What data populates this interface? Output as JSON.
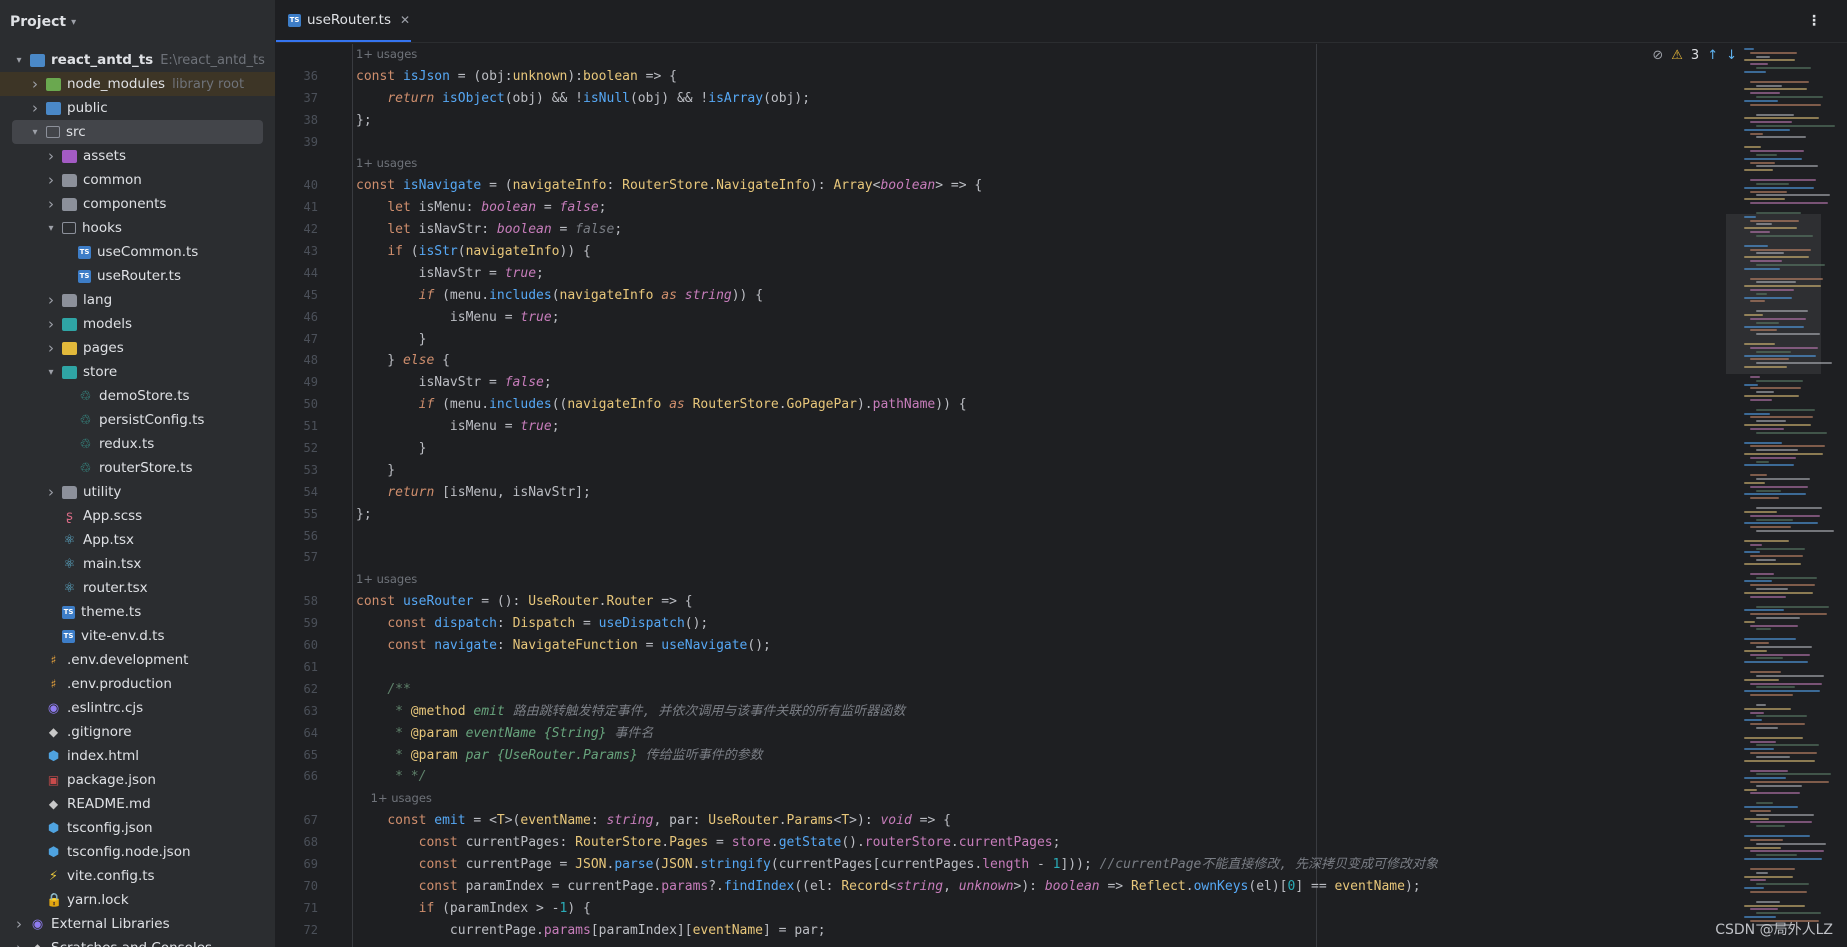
{
  "sidebar": {
    "title": "Project",
    "tree": [
      {
        "label": "react_antd_ts",
        "hint": "E:\\react_antd_ts",
        "level": 0,
        "twisty": "open",
        "icon": "module",
        "bold": true
      },
      {
        "label": "node_modules",
        "hint": "library root",
        "level": 1,
        "twisty": "closed",
        "icon": "folder-green"
      },
      {
        "label": "public",
        "hint": "",
        "level": 1,
        "twisty": "closed",
        "icon": "folder-blue"
      },
      {
        "label": "src",
        "hint": "",
        "level": 1,
        "twisty": "open",
        "icon": "folder-outline",
        "selected": true
      },
      {
        "label": "assets",
        "hint": "",
        "level": 2,
        "twisty": "closed",
        "icon": "folder-purple"
      },
      {
        "label": "common",
        "hint": "",
        "level": 2,
        "twisty": "closed",
        "icon": "folder"
      },
      {
        "label": "components",
        "hint": "",
        "level": 2,
        "twisty": "closed",
        "icon": "folder"
      },
      {
        "label": "hooks",
        "hint": "",
        "level": 2,
        "twisty": "open",
        "icon": "folder-outline"
      },
      {
        "label": "useCommon.ts",
        "hint": "",
        "level": 3,
        "twisty": "",
        "icon": "ts"
      },
      {
        "label": "useRouter.ts",
        "hint": "",
        "level": 3,
        "twisty": "",
        "icon": "ts"
      },
      {
        "label": "lang",
        "hint": "",
        "level": 2,
        "twisty": "closed",
        "icon": "folder"
      },
      {
        "label": "models",
        "hint": "",
        "level": 2,
        "twisty": "closed",
        "icon": "folder-teal"
      },
      {
        "label": "pages",
        "hint": "",
        "level": 2,
        "twisty": "closed",
        "icon": "folder-yellow"
      },
      {
        "label": "store",
        "hint": "",
        "level": 2,
        "twisty": "open",
        "icon": "folder-teal"
      },
      {
        "label": "demoStore.ts",
        "hint": "",
        "level": 3,
        "twisty": "",
        "icon": "glyph-teal"
      },
      {
        "label": "persistConfig.ts",
        "hint": "",
        "level": 3,
        "twisty": "",
        "icon": "glyph-teal"
      },
      {
        "label": "redux.ts",
        "hint": "",
        "level": 3,
        "twisty": "",
        "icon": "glyph-teal"
      },
      {
        "label": "routerStore.ts",
        "hint": "",
        "level": 3,
        "twisty": "",
        "icon": "glyph-teal"
      },
      {
        "label": "utility",
        "hint": "",
        "level": 2,
        "twisty": "closed",
        "icon": "folder"
      },
      {
        "label": "App.scss",
        "hint": "",
        "level": 2,
        "twisty": "",
        "icon": "glyph-pink"
      },
      {
        "label": "App.tsx",
        "hint": "",
        "level": 2,
        "twisty": "",
        "icon": "glyph"
      },
      {
        "label": "main.tsx",
        "hint": "",
        "level": 2,
        "twisty": "",
        "icon": "glyph"
      },
      {
        "label": "router.tsx",
        "hint": "",
        "level": 2,
        "twisty": "",
        "icon": "glyph"
      },
      {
        "label": "theme.ts",
        "hint": "",
        "level": 2,
        "twisty": "",
        "icon": "ts"
      },
      {
        "label": "vite-env.d.ts",
        "hint": "",
        "level": 2,
        "twisty": "",
        "icon": "ts"
      },
      {
        "label": ".env.development",
        "hint": "",
        "level": 1,
        "twisty": "",
        "icon": "glyph-orange"
      },
      {
        "label": ".env.production",
        "hint": "",
        "level": 1,
        "twisty": "",
        "icon": "glyph-orange"
      },
      {
        "label": ".eslintrc.cjs",
        "hint": "",
        "level": 1,
        "twisty": "",
        "icon": "glyph-purple"
      },
      {
        "label": ".gitignore",
        "hint": "",
        "level": 1,
        "twisty": "",
        "icon": "glyph-gray"
      },
      {
        "label": "index.html",
        "hint": "",
        "level": 1,
        "twisty": "",
        "icon": "glyph-blue"
      },
      {
        "label": "package.json",
        "hint": "",
        "level": 1,
        "twisty": "",
        "icon": "glyph-pkg"
      },
      {
        "label": "README.md",
        "hint": "",
        "level": 1,
        "twisty": "",
        "icon": "glyph-gray"
      },
      {
        "label": "tsconfig.json",
        "hint": "",
        "level": 1,
        "twisty": "",
        "icon": "glyph-blue"
      },
      {
        "label": "tsconfig.node.json",
        "hint": "",
        "level": 1,
        "twisty": "",
        "icon": "glyph-blue"
      },
      {
        "label": "vite.config.ts",
        "hint": "",
        "level": 1,
        "twisty": "",
        "icon": "glyph-yellow"
      },
      {
        "label": "yarn.lock",
        "hint": "",
        "level": 1,
        "twisty": "",
        "icon": "glyph-red"
      },
      {
        "label": "External Libraries",
        "hint": "",
        "level": 0,
        "twisty": "closed",
        "icon": "glyph-purple"
      },
      {
        "label": "Scratches and Consoles",
        "hint": "",
        "level": 0,
        "twisty": "closed",
        "icon": "glyph-gray"
      }
    ]
  },
  "editor": {
    "tab_label": "useRouter.ts",
    "tab_close": "✕",
    "menu_glyph": "⋮",
    "inspection": {
      "hidden_icon": "eye-slash-icon",
      "warning_glyph": "⚠",
      "warning_count": "3",
      "up": "↑",
      "down": "↓"
    },
    "lines": [
      {
        "n": "",
        "usages": "1+ usages"
      },
      {
        "n": "36",
        "html": "<span class='k'>const</span> <span class='fn'>isJson</span> = (obj:<span class='ty'>unknown</span>):<span class='ty'>boolean</span> => {"
      },
      {
        "n": "37",
        "html": "    <span class='kw'>return</span> <span class='fn'>isObject</span>(obj) && !<span class='fn'>isNull</span>(obj) && !<span class='fn'>isArray</span>(obj);"
      },
      {
        "n": "38",
        "html": "};"
      },
      {
        "n": "39",
        "html": ""
      },
      {
        "n": "",
        "usages": "1+ usages"
      },
      {
        "n": "40",
        "html": "<span class='k'>const</span> <span class='fn'>isNavigate</span> = (<span class='ty'>navigateInfo</span>: <span class='ty'>RouterStore</span>.<span class='ty'>NavigateInfo</span>): <span class='ty'>Array</span>&lt;<span class='kwi'>boolean</span>&gt; => {"
      },
      {
        "n": "41",
        "html": "    <span class='k'>let</span> isMenu: <span class='kwi'>boolean</span> = <span class='kwi'>false</span>;"
      },
      {
        "n": "42",
        "html": "    <span class='k'>let</span> isNavStr: <span class='kwi'>boolean</span> = <span class='falsegray'>false</span>;"
      },
      {
        "n": "43",
        "html": "    <span class='k'>if</span> (<span class='fn'>isStr</span>(<span class='ty'>navigateInfo</span>)) {"
      },
      {
        "n": "44",
        "html": "        isNavStr = <span class='kwi'>true</span>;"
      },
      {
        "n": "45",
        "html": "        <span class='kw'>if</span> (menu.<span class='fn'>includes</span>(<span class='ty'>navigateInfo</span> <span class='kw'>as</span> <span class='kwi'>string</span>)) {"
      },
      {
        "n": "46",
        "html": "            isMenu = <span class='kwi'>true</span>;"
      },
      {
        "n": "47",
        "html": "        }"
      },
      {
        "n": "48",
        "html": "    } <span class='kw'>else</span> {"
      },
      {
        "n": "49",
        "html": "        isNavStr = <span class='kwi'>false</span>;"
      },
      {
        "n": "50",
        "html": "        <span class='kw'>if</span> (menu.<span class='fn'>includes</span>((<span class='ty'>navigateInfo</span> <span class='kw'>as</span> <span class='ty'>RouterStore</span>.<span class='ty'>GoPagePar</span>).<span class='pr'>pathName</span>)) {"
      },
      {
        "n": "51",
        "html": "            isMenu = <span class='kwi'>true</span>;"
      },
      {
        "n": "52",
        "html": "        }"
      },
      {
        "n": "53",
        "html": "    }"
      },
      {
        "n": "54",
        "html": "    <span class='kw'>return</span> [isMenu, isNavStr];"
      },
      {
        "n": "55",
        "html": "};"
      },
      {
        "n": "56",
        "html": ""
      },
      {
        "n": "57",
        "html": ""
      },
      {
        "n": "",
        "usages": "1+ usages"
      },
      {
        "n": "58",
        "html": "<span class='k'>const</span> <span class='fn'>useRouter</span> = (): <span class='ty'>UseRouter</span>.<span class='ty'>Router</span> => {"
      },
      {
        "n": "59",
        "html": "    <span class='k'>const</span> <span class='fn'>dispatch</span>: <span class='ty'>Dispatch</span> = <span class='fn'>useDispatch</span>();"
      },
      {
        "n": "60",
        "html": "    <span class='k'>const</span> <span class='fn'>navigate</span>: <span class='ty'>NavigateFunction</span> = <span class='fn'>useNavigate</span>();"
      },
      {
        "n": "61",
        "html": ""
      },
      {
        "n": "62",
        "html": "    <span class='cmt'>/**</span>"
      },
      {
        "n": "63",
        "html": "    <span class='cmt'> * </span><span class='ty'>@method</span><span class='dt'> emit </span><span class='cm'>路由跳转触发特定事件, 并依次调用与该事件关联的所有监听器函数</span>"
      },
      {
        "n": "64",
        "html": "    <span class='cmt'> * </span><span class='ty'>@param</span><span class='dt'> eventName {String} </span><span class='cm'>事件名</span>"
      },
      {
        "n": "65",
        "html": "    <span class='cmt'> * </span><span class='ty'>@param</span><span class='dt'> par {UseRouter.Params} </span><span class='cm'>传给监听事件的参数</span>"
      },
      {
        "n": "66",
        "html": "    <span class='cmt'> * */</span>"
      },
      {
        "n": "",
        "usages": "    1+ usages"
      },
      {
        "n": "67",
        "html": "    <span class='k'>const</span> <span class='fn'>emit</span> = &lt;<span class='ty'>T</span>&gt;(<span class='ty'>eventName</span>: <span class='kwi'>string</span>, par: <span class='ty'>UseRouter</span>.<span class='ty'>Params</span>&lt;<span class='ty'>T</span>&gt;): <span class='kwi'>void</span> => {"
      },
      {
        "n": "68",
        "html": "        <span class='k'>const</span> currentPages: <span class='ty'>RouterStore</span>.<span class='ty'>Pages</span> = <span class='pr'>store</span>.<span class='fn'>getState</span>().<span class='pr'>routerStore</span>.<span class='pr'>currentPages</span>;"
      },
      {
        "n": "69",
        "html": "        <span class='k'>const</span> currentPage = <span class='ty'>JSON</span>.<span class='fn'>parse</span>(<span class='ty'>JSON</span>.<span class='fn'>stringify</span>(currentPages[currentPages.<span class='pr'>length</span> - <span class='nb'>1</span>])); <span class='cm'>//currentPage不能直接修改, 先深拷贝变成可修改对象</span>"
      },
      {
        "n": "70",
        "html": "        <span class='k'>const</span> paramIndex = currentPage.<span class='pr'>params</span>?.<span class='fn'>findIndex</span>((el: <span class='ty'>Record</span>&lt;<span class='kwi'>string</span>, <span class='kwi'>unknown</span>&gt;): <span class='kwi'>boolean</span> => <span class='ty'>Reflect</span>.<span class='fn'>ownKeys</span>(el)[<span class='nb'>0</span>] == <span class='ty'>eventName</span>);"
      },
      {
        "n": "71",
        "html": "        <span class='k'>if</span> (paramIndex > -<span class='nb'>1</span>) {"
      },
      {
        "n": "72",
        "html": "            currentPage.<span class='pr'>params</span>[paramIndex][<span class='ty'>eventName</span>] = par;"
      }
    ]
  },
  "watermark": "CSDN @局外人LZ",
  "colors": {
    "accent": "#3574f0",
    "background": "#1e1f22",
    "sidebar": "#2b2d30"
  }
}
